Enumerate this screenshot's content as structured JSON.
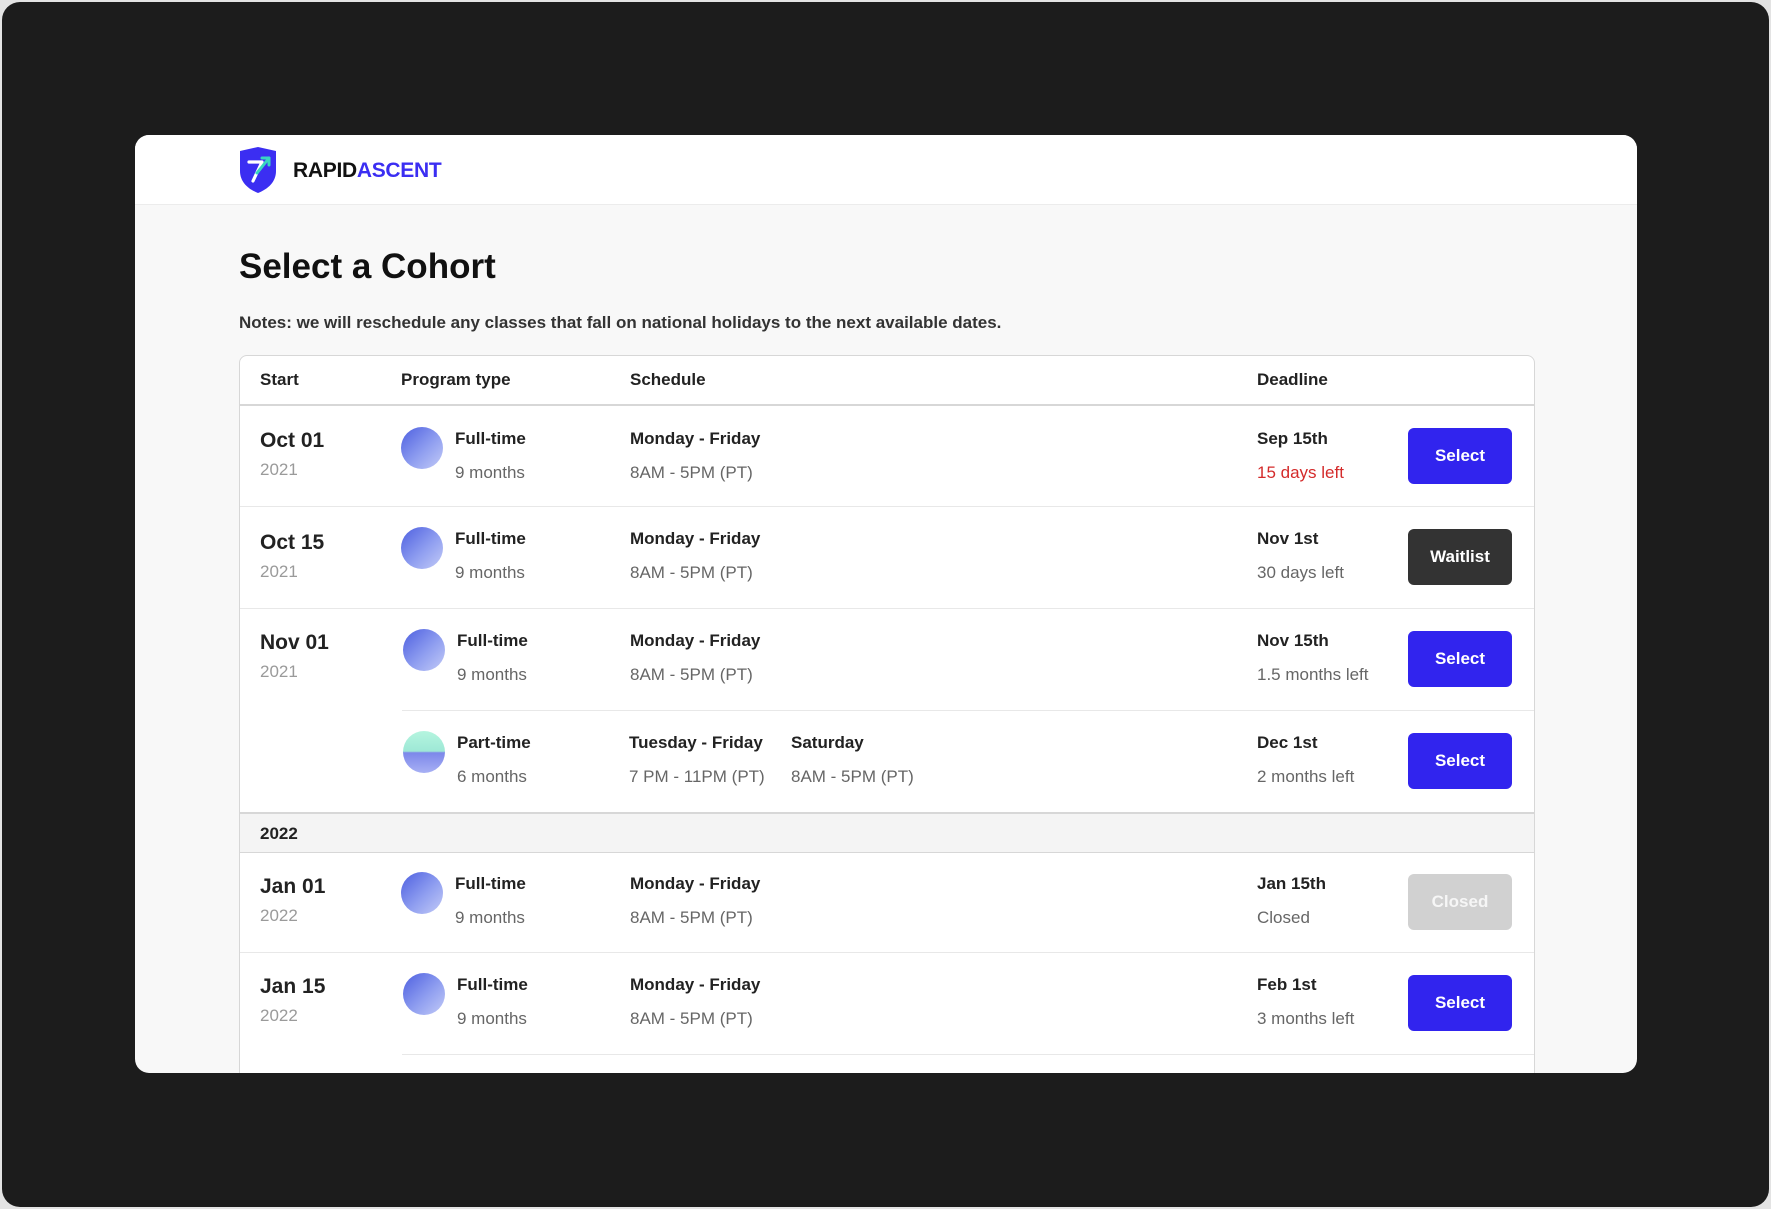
{
  "brand": {
    "name_part1": "RAPID",
    "name_part2": "ASCENT",
    "accent_color": "#3b2ef2"
  },
  "page": {
    "title": "Select a Cohort",
    "notes": "Notes: we will reschedule any classes that fall on national holidays to the next available dates."
  },
  "table": {
    "headers": {
      "start": "Start",
      "program_type": "Program type",
      "schedule": "Schedule",
      "deadline": "Deadline"
    },
    "year_group_label": "2022",
    "rows": [
      {
        "start_date": "Oct 01",
        "start_year": "2021",
        "program": "Full-time",
        "duration": "9 months",
        "icon": "full-time-icon",
        "schedule_days": "Monday - Friday",
        "schedule_hours": "8AM - 5PM (PT)",
        "deadline": "Sep 15th",
        "remaining": "15 days left",
        "remaining_urgent": true,
        "action": "Select"
      },
      {
        "start_date": "Oct 15",
        "start_year": "2021",
        "program": "Full-time",
        "duration": "9 months",
        "icon": "full-time-icon",
        "schedule_days": "Monday - Friday",
        "schedule_hours": "8AM - 5PM (PT)",
        "deadline": "Nov 1st",
        "remaining": "30 days left",
        "action": "Waitlist"
      },
      {
        "start_date": "Nov 01",
        "start_year": "2021",
        "program": "Full-time",
        "duration": "9 months",
        "icon": "full-time-icon",
        "schedule_days": "Monday - Friday",
        "schedule_hours": "8AM - 5PM (PT)",
        "deadline": "Nov 15th",
        "remaining": "1.5 months left",
        "action": "Select"
      },
      {
        "program": "Part-time",
        "duration": "6 months",
        "icon": "part-time-icon",
        "schedule_days": "Tuesday - Friday",
        "schedule_hours": "7 PM - 11PM (PT)",
        "schedule_days_2": "Saturday",
        "schedule_hours_2": "8AM - 5PM (PT)",
        "deadline": "Dec 1st",
        "remaining": "2 months left",
        "action": "Select"
      },
      {
        "start_date": "Jan 01",
        "start_year": "2022",
        "program": "Full-time",
        "duration": "9 months",
        "icon": "full-time-icon",
        "schedule_days": "Monday - Friday",
        "schedule_hours": "8AM - 5PM (PT)",
        "deadline": "Jan 15th",
        "remaining": "Closed",
        "action": "Closed"
      },
      {
        "start_date": "Jan 15",
        "start_year": "2022",
        "program": "Full-time",
        "duration": "9 months",
        "icon": "full-time-icon",
        "schedule_days": "Monday - Friday",
        "schedule_hours": "8AM - 5PM (PT)",
        "deadline": "Feb 1st",
        "remaining": "3 months left",
        "action": "Select"
      }
    ]
  },
  "colors": {
    "select_button": "#3124ee",
    "waitlist_button": "#333333",
    "closed_button": "#d1d1d1",
    "urgent_text": "#d42b2b"
  }
}
